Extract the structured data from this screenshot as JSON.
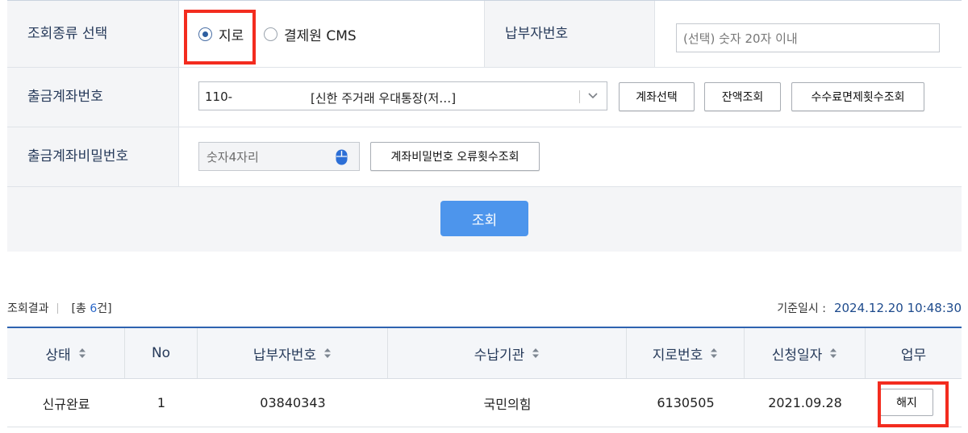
{
  "form": {
    "inquiry_type_label": "조회종류 선택",
    "radio_giro": "지로",
    "radio_cms": "결제원 CMS",
    "payer_number_label": "납부자번호",
    "payer_number_placeholder": "(선택) 숫자 20자 이내",
    "account_label": "출금계좌번호",
    "account_number": "110-",
    "account_name": "[신한 주거래 우대통장(저…]",
    "btn_select_account": "계좌선택",
    "btn_balance": "잔액조회",
    "btn_fee_exempt": "수수료면제횟수조회",
    "password_label": "출금계좌비밀번호",
    "password_placeholder": "숫자4자리",
    "btn_pw_errors": "계좌비밀번호 오류횟수조회",
    "btn_search": "조회"
  },
  "results": {
    "label": "조회결과",
    "count_prefix": "[총 ",
    "count": "6",
    "count_suffix": "건]",
    "base_date_label": "기준일시 :",
    "base_date": "2024.12.20 10:48:30",
    "columns": [
      "상태",
      "No",
      "납부자번호",
      "수납기관",
      "지로번호",
      "신청일자",
      "업무"
    ],
    "rows": [
      {
        "status": "신규완료",
        "no": "1",
        "payer_no": "03840343",
        "org": "국민의힘",
        "giro_no": "6130505",
        "date": "2021.09.28",
        "action": "해지"
      }
    ]
  },
  "colors": {
    "accent": "#4d95ec",
    "highlight": "#f32c1f",
    "table_top_border": "#2e63b0"
  },
  "icons": [
    "chevron-down-icon",
    "mouse-icon",
    "sort-icon"
  ]
}
